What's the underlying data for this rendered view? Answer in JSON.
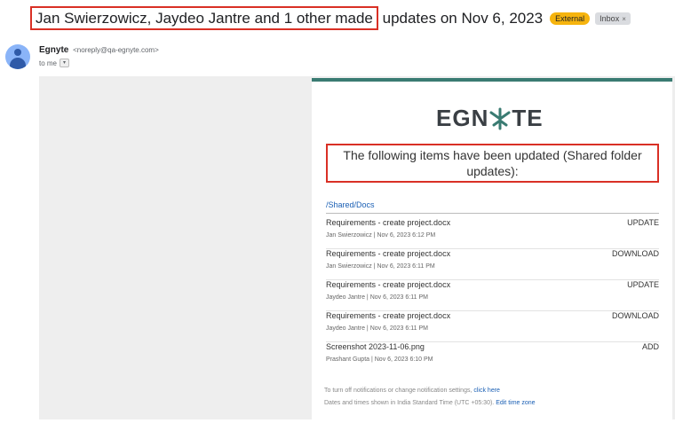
{
  "subject": {
    "highlighted": "Jan Swierzowicz, Jaydeo Jantre and 1 other made",
    "rest": "updates on Nov 6, 2023",
    "external_label": "External",
    "inbox_label": "Inbox",
    "inbox_close": "×"
  },
  "sender": {
    "name": "Egnyte",
    "email": "<noreply@qa-egnyte.com>",
    "to": "to me"
  },
  "email_body": {
    "logo_text_left": "EGN",
    "logo_text_right": "TE",
    "heading": "The following items have been updated (Shared folder updates):",
    "path": "/Shared/Docs",
    "items": [
      {
        "file": "Requirements - create project.docx",
        "user": "Jan Swierzowicz",
        "time": "Nov 6, 2023 6:12 PM",
        "action": "UPDATE"
      },
      {
        "file": "Requirements - create project.docx",
        "user": "Jan Swierzowicz",
        "time": "Nov 6, 2023 6:11 PM",
        "action": "DOWNLOAD"
      },
      {
        "file": "Requirements - create project.docx",
        "user": "Jaydeo Jantre",
        "time": "Nov 6, 2023 6:11 PM",
        "action": "UPDATE"
      },
      {
        "file": "Requirements - create project.docx",
        "user": "Jaydeo Jantre",
        "time": "Nov 6, 2023 6:11 PM",
        "action": "DOWNLOAD"
      },
      {
        "file": "Screenshot 2023-11-06.png",
        "user": "Prashant Gupta",
        "time": "Nov 6, 2023 6:10 PM",
        "action": "ADD"
      }
    ],
    "footer_line1_text": "To turn off notifications or change notification settings,",
    "footer_line1_link": "click here",
    "footer_line2_text": "Dates and times shown in India Standard Time (UTC +05:30).",
    "footer_line2_link": "Edit time zone"
  },
  "colors": {
    "accent_teal": "#3a7b72",
    "highlight_red": "#d93025",
    "external_badge": "#f6b40e",
    "link_blue": "#1a5fb4"
  }
}
